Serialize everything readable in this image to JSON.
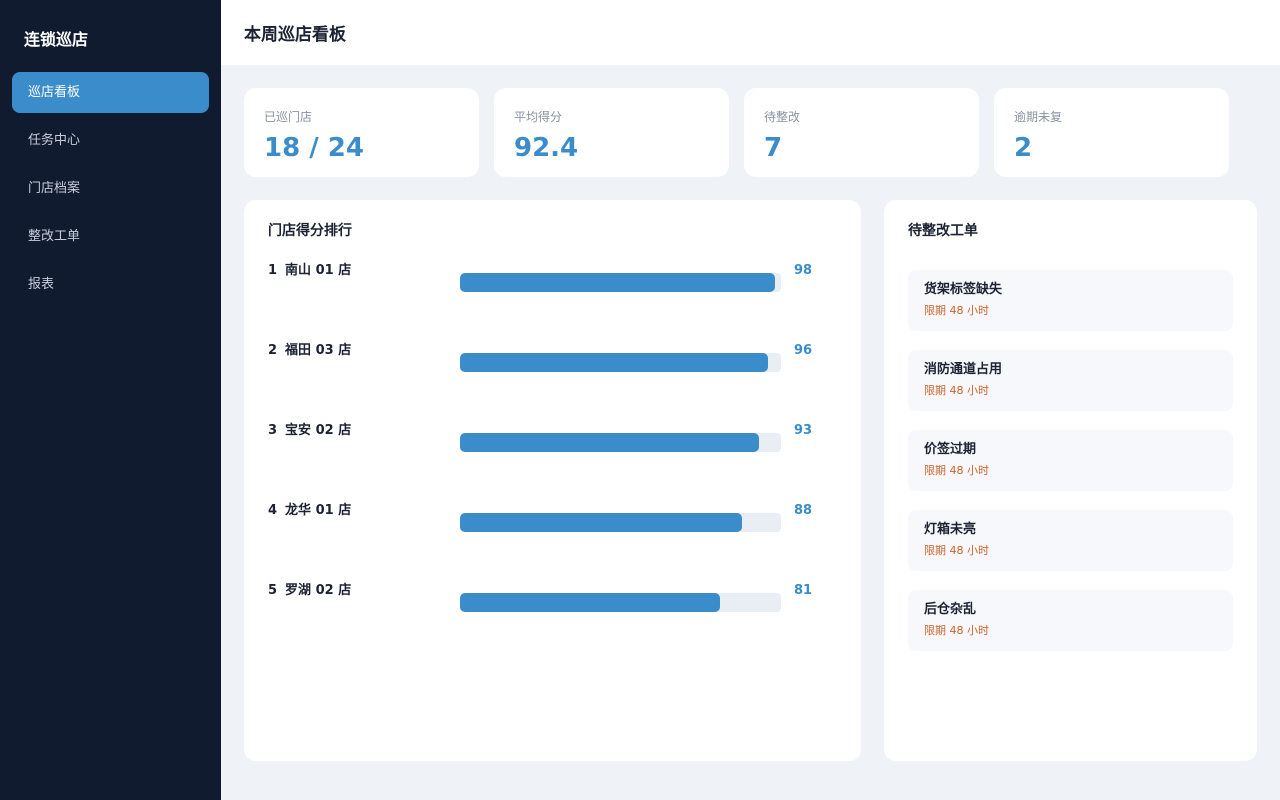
{
  "sidebar": {
    "brand": "连锁巡店",
    "items": [
      {
        "label": "巡店看板",
        "active": true
      },
      {
        "label": "任务中心",
        "active": false
      },
      {
        "label": "门店档案",
        "active": false
      },
      {
        "label": "整改工单",
        "active": false
      },
      {
        "label": "报表",
        "active": false
      }
    ]
  },
  "header": {
    "title": "本周巡店看板"
  },
  "stats": [
    {
      "label": "已巡门店",
      "value": "18 / 24"
    },
    {
      "label": "平均得分",
      "value": "92.4"
    },
    {
      "label": "待整改",
      "value": "7"
    },
    {
      "label": "逾期未复",
      "value": "2"
    }
  ],
  "ranking": {
    "title": "门店得分排行",
    "max_score": 100,
    "rows": [
      {
        "rank": "1",
        "store": "南山 01 店",
        "score": 98
      },
      {
        "rank": "2",
        "store": "福田 03 店",
        "score": 96
      },
      {
        "rank": "3",
        "store": "宝安 02 店",
        "score": 93
      },
      {
        "rank": "4",
        "store": "龙华 01 店",
        "score": 88
      },
      {
        "rank": "5",
        "store": "罗湖 02 店",
        "score": 81
      }
    ]
  },
  "todos": {
    "title": "待整改工单",
    "items": [
      {
        "name": "货架标签缺失",
        "deadline": "限期 48 小时"
      },
      {
        "name": "消防通道占用",
        "deadline": "限期 48 小时"
      },
      {
        "name": "价签过期",
        "deadline": "限期 48 小时"
      },
      {
        "name": "灯箱未亮",
        "deadline": "限期 48 小时"
      },
      {
        "name": "后仓杂乱",
        "deadline": "限期 48 小时"
      }
    ]
  },
  "colors": {
    "accent": "#3b8ccb",
    "sidebar_bg": "#111b30",
    "warning": "#d0622f"
  }
}
